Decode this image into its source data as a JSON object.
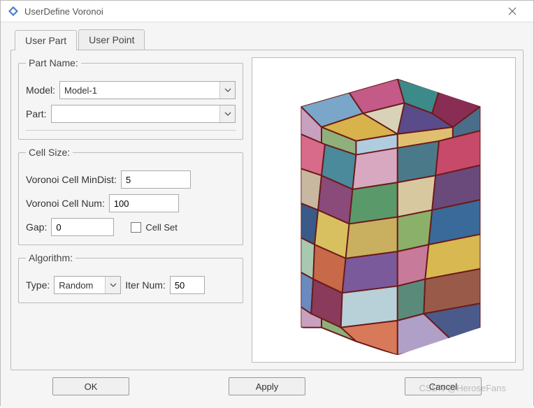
{
  "window": {
    "title": "UserDefine Voronoi"
  },
  "tabs": {
    "user_part": "User Part",
    "user_point": "User Point"
  },
  "part_name": {
    "legend": "Part Name:",
    "model_label": "Model:",
    "model_value": "Model-1",
    "part_label": "Part:",
    "part_value": ""
  },
  "cell_size": {
    "legend": "Cell Size:",
    "mindist_label": "Voronoi Cell MinDist:",
    "mindist_value": "5",
    "num_label": "Voronoi Cell Num:",
    "num_value": "100",
    "gap_label": "Gap:",
    "gap_value": "0",
    "cellset_label": "Cell Set",
    "cellset_checked": false
  },
  "algorithm": {
    "legend": "Algorithm:",
    "type_label": "Type:",
    "type_value": "Random",
    "iter_label": "Iter Num:",
    "iter_value": "50"
  },
  "buttons": {
    "ok": "OK",
    "apply": "Apply",
    "cancel": "Cancel"
  },
  "watermark": "CSDN @HeroseFans"
}
